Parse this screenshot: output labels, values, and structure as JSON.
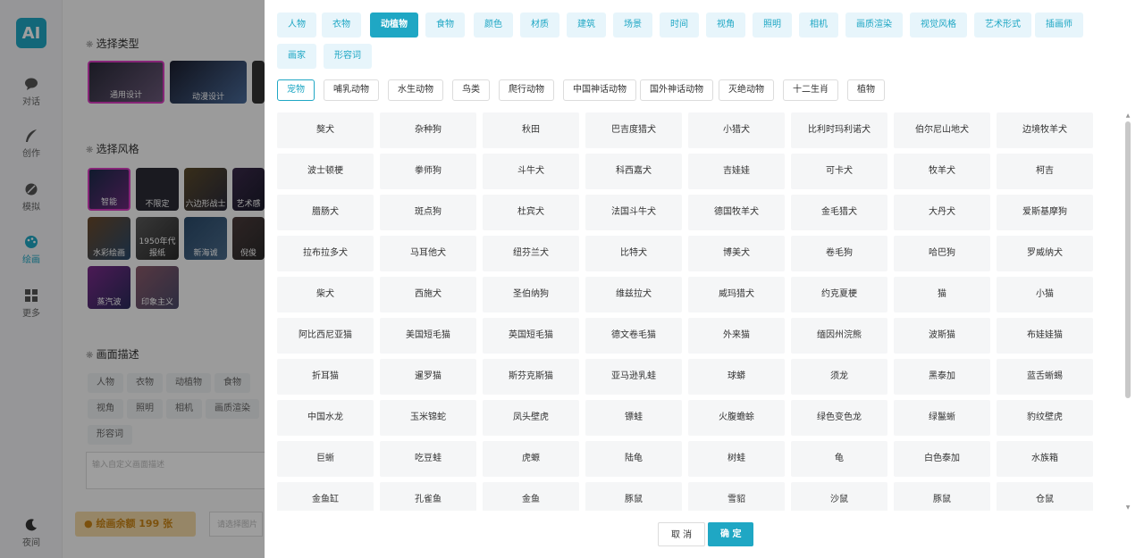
{
  "nav": {
    "logo": "AI",
    "items": [
      {
        "label": "对话",
        "icon": "chat-icon"
      },
      {
        "label": "创作",
        "icon": "quill-icon"
      },
      {
        "label": "模拟",
        "icon": "seed-icon"
      },
      {
        "label": "绘画",
        "icon": "palette-icon"
      },
      {
        "label": "更多",
        "icon": "grid-icon"
      }
    ],
    "night": {
      "label": "夜间",
      "icon": "moon-icon"
    }
  },
  "panel": {
    "type_title": "选择类型",
    "types": [
      "通用设计",
      "动漫设计"
    ],
    "style_title": "选择风格",
    "styles": [
      "智能",
      "不限定",
      "六边形战士",
      "艺术感",
      "水彩绘画",
      "1950年代报纸",
      "新海诚",
      "倪俊",
      "蒸汽波",
      "印象主义"
    ],
    "desc_title": "画面描述",
    "desc_chips": [
      "人物",
      "衣物",
      "动植物",
      "食物",
      "视角",
      "照明",
      "相机",
      "画质渲染",
      "形容词"
    ],
    "desc_placeholder": "输入自定义画面描述",
    "credit": "绘画余额 199 张",
    "select_placeholder": "请选择图片"
  },
  "drawer": {
    "categories": [
      "人物",
      "衣物",
      "动植物",
      "食物",
      "颜色",
      "材质",
      "建筑",
      "场景",
      "时间",
      "视角",
      "照明",
      "相机",
      "画质渲染",
      "视觉风格",
      "艺术形式",
      "插画师",
      "画家",
      "形容词"
    ],
    "active_category": "动植物",
    "subcategories": [
      "宠物",
      "哺乳动物",
      "水生动物",
      "鸟类",
      "爬行动物",
      "中国神话动物",
      "国外神话动物",
      "灭绝动物",
      "十二生肖",
      "植物"
    ],
    "active_subcategory": "宠物",
    "items": [
      "獒犬",
      "杂种狗",
      "秋田",
      "巴吉度猎犬",
      "小猎犬",
      "比利时玛利诺犬",
      "伯尔尼山地犬",
      "边境牧羊犬",
      "波士顿梗",
      "拳师狗",
      "斗牛犬",
      "科西嘉犬",
      "吉娃娃",
      "可卡犬",
      "牧羊犬",
      "柯吉",
      "腊肠犬",
      "斑点狗",
      "杜宾犬",
      "法国斗牛犬",
      "德国牧羊犬",
      "金毛猎犬",
      "大丹犬",
      "爱斯基摩狗",
      "拉布拉多犬",
      "马耳他犬",
      "纽芬兰犬",
      "比特犬",
      "博美犬",
      "卷毛狗",
      "哈巴狗",
      "罗威纳犬",
      "柴犬",
      "西施犬",
      "圣伯纳狗",
      "维兹拉犬",
      "威玛猎犬",
      "约克夏梗",
      "猫",
      "小猫",
      "阿比西尼亚猫",
      "美国短毛猫",
      "英国短毛猫",
      "德文卷毛猫",
      "外来猫",
      "缅因州浣熊",
      "波斯猫",
      "布娃娃猫",
      "折耳猫",
      "暹罗猫",
      "斯芬克斯猫",
      "亚马逊乳蛙",
      "球蟒",
      "须龙",
      "黑泰加",
      "蓝舌蜥蜴",
      "中国水龙",
      "玉米锦蛇",
      "凤头壁虎",
      "镖蛙",
      "火腹蟾蜍",
      "绿色变色龙",
      "绿鬣蜥",
      "豹纹壁虎",
      "巨蜥",
      "吃豆蛙",
      "虎螈",
      "陆龟",
      "树蛙",
      "龟",
      "白色泰加",
      "水族箱",
      "金鱼缸",
      "孔雀鱼",
      "金鱼",
      "豚鼠",
      "雪貂",
      "沙鼠",
      "豚鼠",
      "仓鼠"
    ],
    "cancel": "取 消",
    "confirm": "确 定"
  },
  "colors": {
    "accent": "#1fa7c4",
    "chip_bg": "#e7f5fb",
    "credit_bg": "#f3d9a6"
  }
}
